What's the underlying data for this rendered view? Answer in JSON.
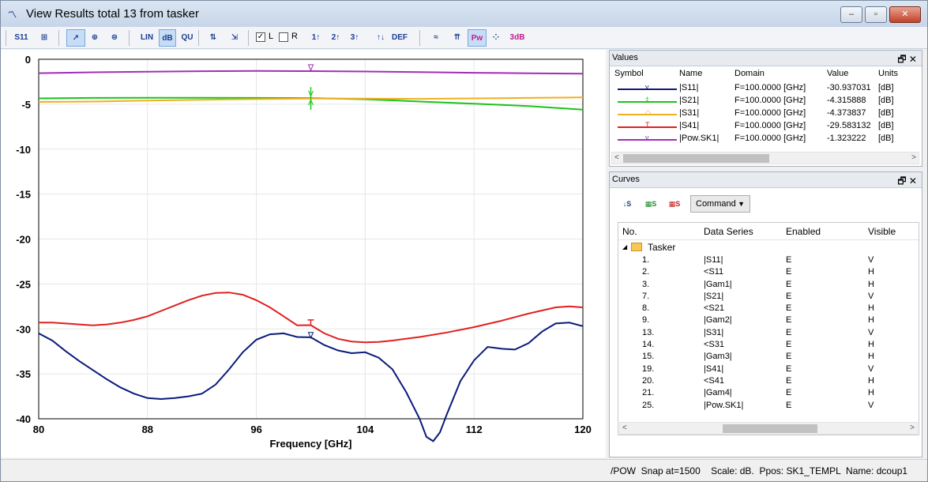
{
  "window": {
    "title": "View Results total 13 from tasker",
    "icon": "chart-app-icon",
    "controls": {
      "minimize": "–",
      "maximize": "▫",
      "close": "✕"
    }
  },
  "toolbar": {
    "items": [
      {
        "name": "s11-view-icon",
        "label": "S11"
      },
      {
        "name": "fit-icon",
        "label": "⊞"
      },
      {
        "name": "cursor-icon",
        "label": "↗"
      },
      {
        "name": "polar-icon",
        "label": "⊕"
      },
      {
        "name": "smith-icon",
        "label": "⊜"
      },
      {
        "name": "lin-scale-icon",
        "label": "LIN"
      },
      {
        "name": "db-scale-icon",
        "label": "dB"
      },
      {
        "name": "qu-scale-icon",
        "label": "QU"
      },
      {
        "name": "peak-icon",
        "label": "⇅"
      },
      {
        "name": "zoom-icon",
        "label": "⇲"
      },
      {
        "name": "port1-icon",
        "label": "1↑"
      },
      {
        "name": "port2-icon",
        "label": "2↑"
      },
      {
        "name": "port3-icon",
        "label": "3↑"
      },
      {
        "name": "ins-icon",
        "label": "↑↓"
      },
      {
        "name": "def-icon",
        "label": "DEF"
      },
      {
        "name": "wave-icon",
        "label": "≈"
      },
      {
        "name": "marker-icon",
        "label": "⇈"
      },
      {
        "name": "pow-icon",
        "label": "Pw"
      },
      {
        "name": "dots-icon",
        "label": "⁘"
      },
      {
        "name": "3db-icon",
        "label": "3dB"
      }
    ],
    "checkbox_l": {
      "label": "L",
      "checked": "✓"
    },
    "checkbox_r": {
      "label": "R"
    }
  },
  "chart_data": {
    "type": "line",
    "xlabel": "Frequency [GHz]",
    "xlim": [
      80,
      120
    ],
    "ylim": [
      -40,
      0
    ],
    "xticks": [
      "80",
      "88",
      "96",
      "104",
      "112",
      "120"
    ],
    "yticks": [
      "0",
      "-5",
      "-10",
      "-15",
      "-20",
      "-25",
      "-30",
      "-35",
      "-40"
    ],
    "grid": true,
    "marker_x": 100,
    "series": [
      {
        "name": "|S11|",
        "color": "#0a1a7a",
        "x": [
          80,
          81,
          82,
          83,
          84,
          85,
          86,
          87,
          88,
          89,
          90,
          91,
          92,
          93,
          94,
          95,
          96,
          97,
          98,
          99,
          100,
          101,
          102,
          103,
          104,
          105,
          106,
          107,
          108,
          108.5,
          109,
          109.5,
          110,
          111,
          112,
          113,
          114,
          115,
          116,
          117,
          118,
          119,
          120
        ],
        "y": [
          -30.5,
          -31.3,
          -32.5,
          -33.6,
          -34.6,
          -35.6,
          -36.5,
          -37.2,
          -37.7,
          -37.8,
          -37.7,
          -37.5,
          -37.2,
          -36.2,
          -34.5,
          -32.6,
          -31.2,
          -30.6,
          -30.5,
          -30.9,
          -30.94,
          -31.8,
          -32.4,
          -32.7,
          -32.6,
          -33.2,
          -34.5,
          -37.0,
          -40.0,
          -42.0,
          -42.5,
          -41.5,
          -39.5,
          -35.8,
          -33.5,
          -32.0,
          -32.2,
          -32.3,
          -31.6,
          -30.3,
          -29.4,
          -29.3,
          -29.7
        ]
      },
      {
        "name": "|S21|",
        "color": "#1bc41b",
        "x": [
          80,
          84,
          88,
          92,
          96,
          100,
          104,
          108,
          112,
          116,
          120
        ],
        "y": [
          -4.35,
          -4.3,
          -4.28,
          -4.28,
          -4.3,
          -4.32,
          -4.45,
          -4.7,
          -4.95,
          -5.2,
          -5.6
        ]
      },
      {
        "name": "|S31|",
        "color": "#f0b020",
        "x": [
          80,
          84,
          88,
          92,
          96,
          100,
          104,
          108,
          112,
          116,
          120
        ],
        "y": [
          -4.75,
          -4.7,
          -4.6,
          -4.5,
          -4.43,
          -4.37,
          -4.38,
          -4.4,
          -4.35,
          -4.3,
          -4.25
        ]
      },
      {
        "name": "|S41|",
        "color": "#e02020",
        "x": [
          80,
          81,
          82,
          83,
          84,
          85,
          86,
          87,
          88,
          89,
          90,
          91,
          92,
          93,
          94,
          95,
          96,
          97,
          98,
          99,
          100,
          101,
          102,
          103,
          104,
          105,
          106,
          108,
          110,
          112,
          114,
          116,
          118,
          119,
          120
        ],
        "y": [
          -29.3,
          -29.3,
          -29.4,
          -29.5,
          -29.6,
          -29.5,
          -29.3,
          -29.0,
          -28.6,
          -28.0,
          -27.4,
          -26.8,
          -26.3,
          -26.0,
          -25.95,
          -26.2,
          -26.8,
          -27.6,
          -28.6,
          -29.6,
          -29.58,
          -30.5,
          -31.1,
          -31.4,
          -31.5,
          -31.45,
          -31.3,
          -30.9,
          -30.4,
          -29.8,
          -29.1,
          -28.3,
          -27.6,
          -27.5,
          -27.6
        ]
      },
      {
        "name": "|Pow.SK1|",
        "color": "#a02fb5",
        "x": [
          80,
          84,
          88,
          92,
          96,
          100,
          104,
          108,
          112,
          116,
          120
        ],
        "y": [
          -1.55,
          -1.45,
          -1.38,
          -1.33,
          -1.3,
          -1.32,
          -1.36,
          -1.42,
          -1.5,
          -1.56,
          -1.6
        ]
      }
    ]
  },
  "values_panel": {
    "title": "Values",
    "columns": [
      "Symbol",
      "Name",
      "Domain",
      "Value",
      "Units"
    ],
    "rows": [
      {
        "name": "|S11|",
        "domain": "F=100.0000 [GHz]",
        "value": "-30.937031",
        "units": "[dB]",
        "color": "#0a1a7a",
        "mark": "v"
      },
      {
        "name": "|S21|",
        "domain": "F=100.0000 [GHz]",
        "value": "-4.315888",
        "units": "[dB]",
        "color": "#1bc41b",
        "mark": "‡"
      },
      {
        "name": "|S31|",
        "domain": "F=100.0000 [GHz]",
        "value": "-4.373837",
        "units": "[dB]",
        "color": "#f0b020",
        "mark": "◇"
      },
      {
        "name": "|S41|",
        "domain": "F=100.0000 [GHz]",
        "value": "-29.583132",
        "units": "[dB]",
        "color": "#e02020",
        "mark": "T"
      },
      {
        "name": "|Pow.SK1|",
        "domain": "F=100.0000 [GHz]",
        "value": "-1.323222",
        "units": "[dB]",
        "color": "#a02fb5",
        "mark": "v"
      }
    ]
  },
  "curves_panel": {
    "title": "Curves",
    "command_label": "Command",
    "columns": [
      "No.",
      "Data Series",
      "Enabled",
      "Visible"
    ],
    "group": "Tasker",
    "rows": [
      {
        "no": "1.",
        "series": "|S11|",
        "enabled": "E",
        "visible": "V"
      },
      {
        "no": "2.",
        "series": "<S11",
        "enabled": "E",
        "visible": "H"
      },
      {
        "no": "3.",
        "series": "|Gam1|",
        "enabled": "E",
        "visible": "H"
      },
      {
        "no": "7.",
        "series": "|S21|",
        "enabled": "E",
        "visible": "V"
      },
      {
        "no": "8.",
        "series": "<S21",
        "enabled": "E",
        "visible": "H"
      },
      {
        "no": "9.",
        "series": "|Gam2|",
        "enabled": "E",
        "visible": "H"
      },
      {
        "no": "13.",
        "series": "|S31|",
        "enabled": "E",
        "visible": "V"
      },
      {
        "no": "14.",
        "series": "<S31",
        "enabled": "E",
        "visible": "H"
      },
      {
        "no": "15.",
        "series": "|Gam3|",
        "enabled": "E",
        "visible": "H"
      },
      {
        "no": "19.",
        "series": "|S41|",
        "enabled": "E",
        "visible": "V"
      },
      {
        "no": "20.",
        "series": "<S41",
        "enabled": "E",
        "visible": "H"
      },
      {
        "no": "21.",
        "series": "|Gam4|",
        "enabled": "E",
        "visible": "H"
      },
      {
        "no": "25.",
        "series": "|Pow.SK1|",
        "enabled": "E",
        "visible": "V"
      }
    ]
  },
  "status": {
    "text": "/POW  Snap at=1500    Scale: dB.  Ppos: SK1_TEMPL  Name: dcoup1"
  }
}
